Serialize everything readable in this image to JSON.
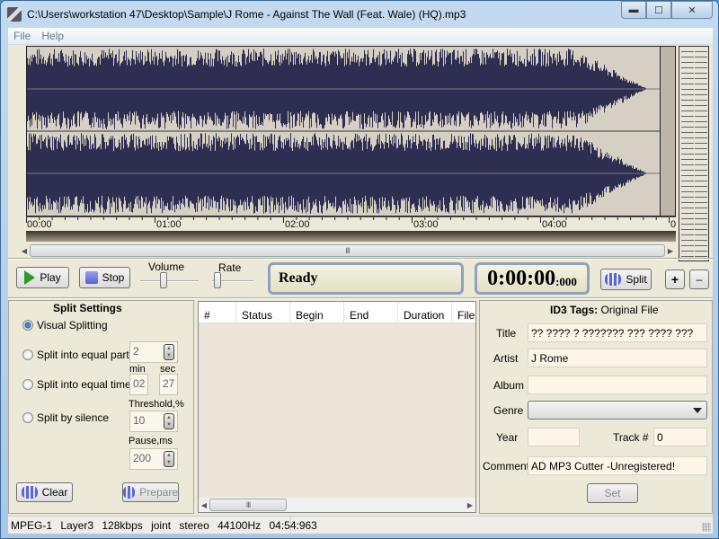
{
  "window": {
    "title": "C:\\Users\\workstation 47\\Desktop\\Sample\\J Rome - Against The Wall (Feat. Wale) (HQ).mp3",
    "minimize": "▬",
    "maximize": "☐",
    "close": "✕"
  },
  "menu": [
    "File",
    "Help"
  ],
  "timeline": {
    "ticks": [
      "00:00",
      "01:00",
      "02:00",
      "03:00",
      "04:00",
      "0"
    ],
    "scroll_thumb": "III"
  },
  "transport": {
    "play_label": "Play",
    "stop_label": "Stop",
    "volume_label": "Volume",
    "rate_label": "Rate",
    "volume_level": 0.4,
    "rate_level": 0.05,
    "status": "Ready",
    "time_main": "0:00:00",
    "time_ms": ":000",
    "split_label": "Split",
    "plus_label": "+",
    "minus_label": "–"
  },
  "split_settings": {
    "title": "Split Settings",
    "options": [
      {
        "label": "Visual Splitting",
        "selected": true
      },
      {
        "label": "Split into equal parts",
        "selected": false
      },
      {
        "label": "Split into equal time",
        "selected": false
      },
      {
        "label": "Split by silence",
        "selected": false
      }
    ],
    "parts_value": "2",
    "min_label": "min",
    "sec_label": "sec",
    "min_value": "02",
    "sec_value": "27",
    "threshold_label": "Threshold,%",
    "threshold_value": "10",
    "pause_label": "Pause,ms",
    "pause_value": "200",
    "clear_label": "Clear",
    "prepare_label": "Prepare"
  },
  "segments_table": {
    "columns": [
      "#",
      "Status",
      "Begin",
      "End",
      "Duration",
      "Filename"
    ],
    "rows": [],
    "scroll_thumb": "III"
  },
  "id3": {
    "title_bold": "ID3 Tags:",
    "title_rest": "Original File",
    "fields": {
      "title_label": "Title",
      "title_value": "?? ???? ? ??????? ??? ???? ???",
      "artist_label": "Artist",
      "artist_value": "J Rome",
      "album_label": "Album",
      "album_value": "",
      "genre_label": "Genre",
      "genre_value": "",
      "year_label": "Year",
      "year_value": "",
      "track_label": "Track #",
      "track_value": "0",
      "comment_label": "Comment",
      "comment_value": "AD MP3 Cutter -Unregistered!"
    },
    "set_label": "Set"
  },
  "statusbar": {
    "text": "MPEG-1  Layer3  128kbps  joint stereo  44100Hz  04:54:963"
  },
  "colors": {
    "waveform": "#2e2e52",
    "waveform_bg": "#d6d0c4",
    "window_bg": "#ece9d8",
    "play_green": "#2a9a2a"
  }
}
